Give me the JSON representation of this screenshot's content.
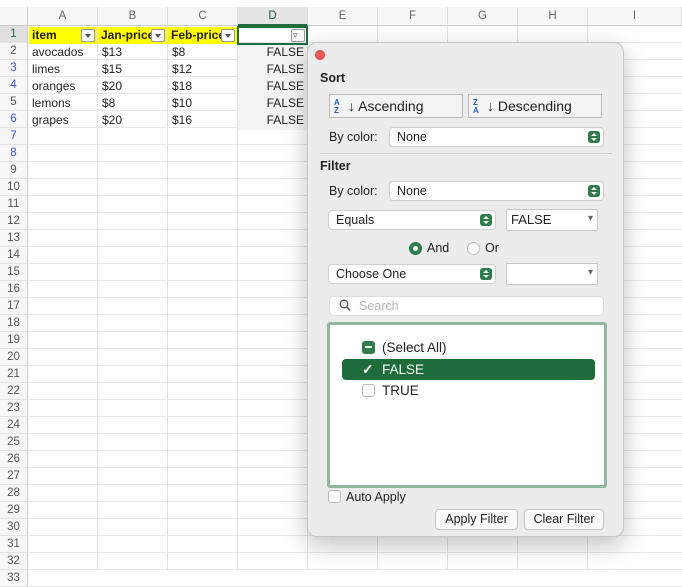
{
  "spreadsheet": {
    "columns": [
      "A",
      "B",
      "C",
      "D",
      "E",
      "F",
      "G",
      "H",
      "I"
    ],
    "row_numbers": [
      "1",
      "2",
      "3",
      "4",
      "5",
      "6",
      "7",
      "8",
      "9",
      "10",
      "11",
      "12",
      "13",
      "14",
      "15",
      "16",
      "17",
      "18",
      "19",
      "20",
      "21",
      "22",
      "23",
      "24",
      "25",
      "26",
      "27",
      "28",
      "29",
      "30",
      "31",
      "32",
      "33"
    ],
    "headers": [
      "item",
      "Jan-price",
      "Feb-price",
      ""
    ],
    "rows": [
      {
        "row": "3",
        "item": "avocados",
        "jan": "$13",
        "feb": "$8",
        "d": "FALSE"
      },
      {
        "row": "4",
        "item": "limes",
        "jan": "$15",
        "feb": "$12",
        "d": "FALSE"
      },
      {
        "row": "6",
        "item": "oranges",
        "jan": "$20",
        "feb": "$18",
        "d": "FALSE"
      },
      {
        "row": "7",
        "item": "lemons",
        "jan": "$8",
        "feb": "$10",
        "d": "FALSE"
      },
      {
        "row": "8",
        "item": "grapes",
        "jan": "$20",
        "feb": "$16",
        "d": "FALSE"
      }
    ]
  },
  "filter_popover": {
    "sort_title": "Sort",
    "ascending_label": "Ascending",
    "descending_label": "Descending",
    "sort_by_color_label": "By color:",
    "sort_by_color_value": "None",
    "filter_title": "Filter",
    "filter_by_color_label": "By color:",
    "filter_by_color_value": "None",
    "condition1_operator": "Equals",
    "condition1_value": "FALSE",
    "and_label": "And",
    "or_label": "Or",
    "condition2_operator": "Choose One",
    "condition2_value": "",
    "search_placeholder": "Search",
    "list_items": [
      {
        "label": "(Select All)",
        "state": "mixed"
      },
      {
        "label": "FALSE",
        "state": "checked"
      },
      {
        "label": "TRUE",
        "state": "unchecked"
      }
    ],
    "auto_apply_label": "Auto Apply",
    "apply_label": "Apply Filter",
    "clear_label": "Clear Filter"
  },
  "colors": {
    "accent_green": "#1e6b3c",
    "header_fill": "#ffff00",
    "filtered_row_number": "#3b54d6"
  }
}
